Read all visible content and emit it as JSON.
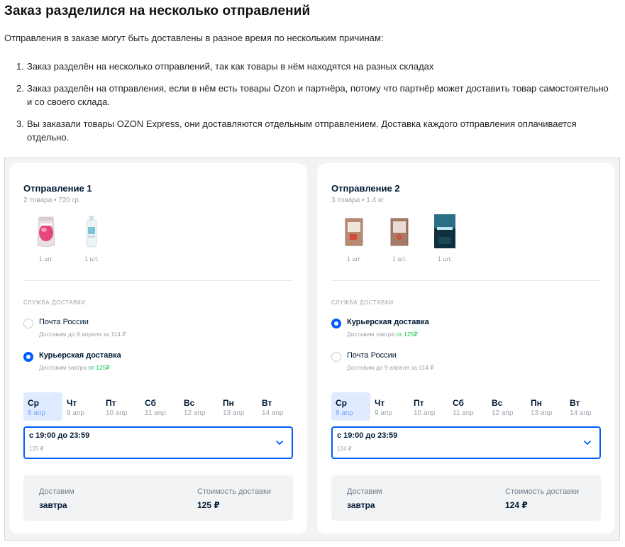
{
  "title": "Заказ разделился на несколько отправлений",
  "intro": "Отправления в заказе могут быть доставлены в разное время по нескольким причинам:",
  "reasons": [
    {
      "num": "1.",
      "text": "Заказ разделён на несколько отправлений, так как товары в нём находятся на разных складах"
    },
    {
      "num": "2.",
      "text": "Заказ разделён на отправления, если в нём есть товары Ozon и партнёра, потому что партнёр может доставить товар самостоятельно и со своего склада."
    },
    {
      "num": "3.",
      "text": "Вы заказали товары OZON Express, они доставляются отдельным отправлением. Доставка каждого отправления оплачивается отдельно."
    }
  ],
  "accent_color": "#005bff",
  "green_color": "#10c44c",
  "shipments": [
    {
      "title": "Отправление 1",
      "subtitle": "2 товара • 720 гр.",
      "items": [
        {
          "icon": "pouch-product-icon",
          "qty": "1 шт."
        },
        {
          "icon": "bottle-product-icon",
          "qty": "1 шт."
        }
      ],
      "service_label": "СЛУЖБА ДОСТАВКИ",
      "options": [
        {
          "name": "Почта России",
          "desc": "Доставим до 9 апреля за 114 ₽",
          "price": "",
          "selected": false
        },
        {
          "name": "Курьерская доставка",
          "desc": "Доставим завтра ",
          "price": "от 125₽",
          "selected": true
        }
      ],
      "days": [
        {
          "name": "Ср",
          "date": "8 апр",
          "selected": true
        },
        {
          "name": "Чт",
          "date": "9 апр"
        },
        {
          "name": "Пт",
          "date": "10 апр"
        },
        {
          "name": "Сб",
          "date": "11 апр"
        },
        {
          "name": "Вс",
          "date": "12 апр"
        },
        {
          "name": "Пн",
          "date": "13 апр"
        },
        {
          "name": "Вт",
          "date": "14 апр"
        }
      ],
      "slot": {
        "label": "с 19:00 до 23:59",
        "price": "125 ₽"
      },
      "summary": {
        "deliver_label": "Доставим",
        "deliver_value": "завтра",
        "cost_label": "Стоимость доставки",
        "cost_value": "125 ₽"
      }
    },
    {
      "title": "Отправление 2",
      "subtitle": "3 товара • 1.4 кг.",
      "items": [
        {
          "icon": "book-product-icon",
          "qty": "1 шт."
        },
        {
          "icon": "book-product-icon",
          "qty": "1 шт."
        },
        {
          "icon": "book-dark-product-icon",
          "qty": "1 шт."
        }
      ],
      "service_label": "СЛУЖБА ДОСТАВКИ",
      "options": [
        {
          "name": "Курьерская доставка",
          "desc": "Доставим завтра ",
          "price": "от 125₽",
          "selected": true
        },
        {
          "name": "Почта России",
          "desc": "Доставим до 9 апреля за 114 ₽",
          "price": "",
          "selected": false
        }
      ],
      "days": [
        {
          "name": "Ср",
          "date": "8 апр",
          "selected": true
        },
        {
          "name": "Чт",
          "date": "9 апр"
        },
        {
          "name": "Пт",
          "date": "10 апр"
        },
        {
          "name": "Сб",
          "date": "11 апр"
        },
        {
          "name": "Вс",
          "date": "12 апр"
        },
        {
          "name": "Пн",
          "date": "13 апр"
        },
        {
          "name": "Вт",
          "date": "14 апр"
        }
      ],
      "slot": {
        "label": "с 19:00 до 23:59",
        "price": "124 ₽"
      },
      "summary": {
        "deliver_label": "Доставим",
        "deliver_value": "завтра",
        "cost_label": "Стоимость доставки",
        "cost_value": "124 ₽"
      }
    }
  ]
}
